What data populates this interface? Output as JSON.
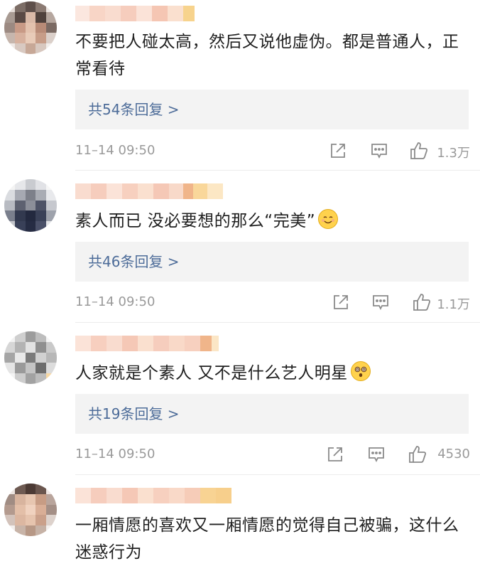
{
  "comments": [
    {
      "text": "不要把人碰太高，然后又说他虚伪。都是普通人，正常看待",
      "replies": "共54条回复 >",
      "time": "11–14 09:50",
      "likes": "1.3万"
    },
    {
      "text": "素人而已 没必要想的那么“完美”",
      "emoji_icon": "smiling-face-icon",
      "replies": "共46条回复 >",
      "time": "11–14 09:50",
      "likes": "1.1万"
    },
    {
      "text": "人家就是个素人 又不是什么艺人明星",
      "emoji_icon": "dizzy-face-icon",
      "replies": "共19条回复 >",
      "time": "11–14 09:50",
      "likes": "4530"
    },
    {
      "text": "一厢情愿的喜欢又一厢情愿的觉得自己被骗，这什么迷惑行为"
    }
  ],
  "colors": {
    "reply_link": "#4d6c99",
    "reply_bg": "#f3f3f3",
    "meta_text": "#9a9a9a"
  }
}
